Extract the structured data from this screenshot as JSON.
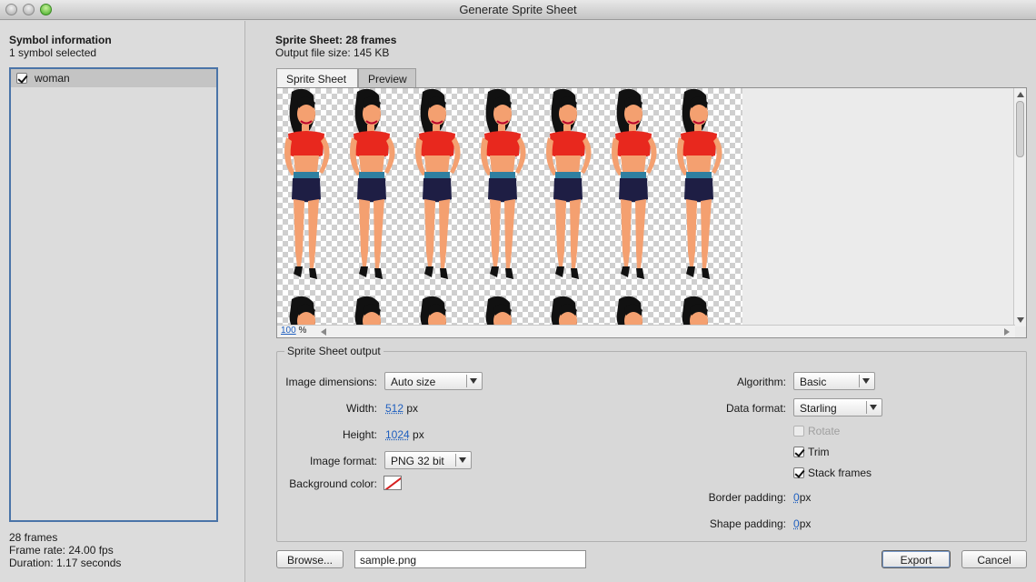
{
  "window": {
    "title": "Generate Sprite Sheet"
  },
  "left": {
    "heading": "Symbol information",
    "selection": "1 symbol selected",
    "symbols": [
      {
        "name": "woman",
        "checked": true
      }
    ],
    "frames": "28 frames",
    "frame_rate": "Frame rate: 24.00 fps",
    "duration": "Duration: 1.17 seconds"
  },
  "summary": {
    "title": "Sprite Sheet: 28 frames",
    "file_size": "Output file size: 145 KB"
  },
  "tabs": [
    {
      "label": "Sprite Sheet",
      "active": true
    },
    {
      "label": "Preview",
      "active": false
    }
  ],
  "preview": {
    "zoom_value": "100",
    "zoom_unit": "%"
  },
  "output": {
    "title": "Sprite Sheet output",
    "image_dimensions": {
      "label": "Image dimensions:",
      "value": "Auto size"
    },
    "width": {
      "label": "Width:",
      "value": "512",
      "unit": "px"
    },
    "height": {
      "label": "Height:",
      "value": "1024",
      "unit": "px"
    },
    "image_format": {
      "label": "Image format:",
      "value": "PNG 32 bit"
    },
    "background_color": {
      "label": "Background color:"
    },
    "algorithm": {
      "label": "Algorithm:",
      "value": "Basic"
    },
    "data_format": {
      "label": "Data format:",
      "value": "Starling"
    },
    "rotate": {
      "label": "Rotate",
      "checked": false,
      "enabled": false
    },
    "trim": {
      "label": "Trim",
      "checked": true
    },
    "stack_frames": {
      "label": "Stack frames",
      "checked": true
    },
    "border_padding": {
      "label": "Border padding:",
      "value": "0",
      "unit": "px"
    },
    "shape_padding": {
      "label": "Shape padding:",
      "value": "0",
      "unit": "px"
    }
  },
  "footer": {
    "browse_label": "Browse...",
    "filename": "sample.png",
    "export_label": "Export",
    "cancel_label": "Cancel"
  }
}
